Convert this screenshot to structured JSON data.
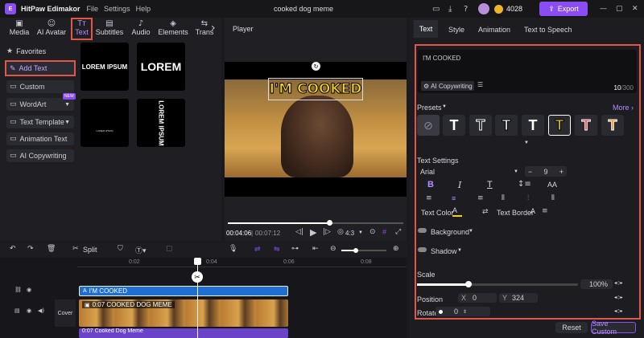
{
  "app": {
    "name": "HitPaw Edimakor",
    "project_title": "cooked dog meme",
    "credits": "4028",
    "export_label": "Export"
  },
  "menu": [
    "File",
    "Settings",
    "Help"
  ],
  "media_tabs": [
    {
      "label": "Media",
      "icon": "media-icon"
    },
    {
      "label": "AI Avatar",
      "icon": "ai-avatar-icon"
    },
    {
      "label": "Text",
      "icon": "text-icon"
    },
    {
      "label": "Subtitles",
      "icon": "subtitles-icon"
    },
    {
      "label": "Audio",
      "icon": "audio-icon"
    },
    {
      "label": "Elements",
      "icon": "elements-icon"
    },
    {
      "label": "Trans",
      "icon": "transition-icon"
    }
  ],
  "sidebar": {
    "items": [
      {
        "label": "Favorites",
        "icon": "star-icon"
      },
      {
        "label": "Add Text",
        "icon": "add-text-icon"
      },
      {
        "label": "Custom",
        "icon": "custom-icon"
      },
      {
        "label": "WordArt",
        "icon": "wordart-icon",
        "badge": "NEW"
      },
      {
        "label": "Text Template",
        "icon": "template-icon"
      },
      {
        "label": "Animation Text",
        "icon": "animation-text-icon"
      },
      {
        "label": "AI Copywriting",
        "icon": "ai-copywriting-icon"
      }
    ]
  },
  "templates": {
    "t1": "LOREM IPSUM",
    "t2": "LOREM",
    "t3": "LOREM IPSUM",
    "t4": "LOREM IPSUM"
  },
  "player": {
    "title": "Player",
    "overlay_text": "I'M COOKED",
    "current_time": "00:04:06",
    "total_time": "00:07:12",
    "ratio": "4:3",
    "progress": 0.58
  },
  "timeline": {
    "split_label": "Split",
    "ticks": [
      "0:02",
      "0:04",
      "0:06",
      "0:08"
    ],
    "text_clip": "I'M COOKED",
    "video_clip": "0:07 COOKED DOG MEME",
    "cover_label": "Cover",
    "audio_clip": "0:07 Cooked Dog Meme"
  },
  "right_panel": {
    "tabs": [
      "Text",
      "Style",
      "Animation",
      "Text to Speech"
    ],
    "text_value": "I'M COOKED",
    "ai_copywriting": "AI Copywriting",
    "char_count": "10",
    "char_max": "/300",
    "presets_label": "Presets",
    "more_label": "More",
    "text_settings_label": "Text Settings",
    "font": "Arial",
    "font_size": "9",
    "aa_label": "AA",
    "text_color_label": "Text Color",
    "text_border_label": "Text Border",
    "background_label": "Background",
    "shadow_label": "Shadow",
    "scale_label": "Scale",
    "scale_value": "100%",
    "scale_fraction": 0.32,
    "position_label": "Position",
    "x_label": "X",
    "x_value": "0",
    "y_label": "Y",
    "y_value": "324",
    "rotate_label": "Rotate",
    "rotate_value": "0",
    "reset_label": "Reset",
    "save_custom_label": "Save Custom"
  },
  "colors": {
    "accent": "#8a4df2",
    "highlight": "#e0574a",
    "yellow": "#f2d21b",
    "panel": "#26262c"
  }
}
